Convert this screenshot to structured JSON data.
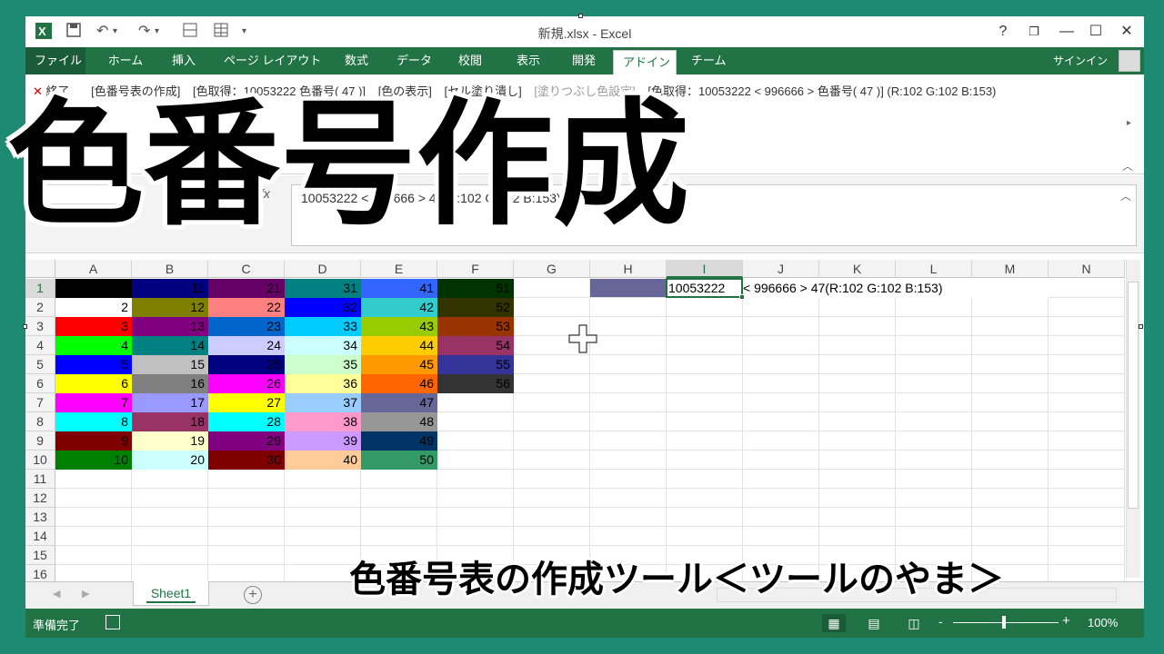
{
  "window": {
    "title": "新規.xlsx - Excel",
    "help_label": "?",
    "restore_label": "❐",
    "minimize_label": "—",
    "maximize_label": "☐",
    "close_label": "✕"
  },
  "quick_access": {
    "excel_icon": "excel-logo-icon",
    "save_icon": "save-icon",
    "undo_icon": "undo-icon",
    "redo_icon": "redo-icon",
    "form_icon": "form-icon",
    "table_icon": "table-icon",
    "customize_icon": "customize-dropdown-icon"
  },
  "ribbon": {
    "tabs": [
      "ファイル",
      "ホーム",
      "挿入",
      "ページ レイアウト",
      "数式",
      "データ",
      "校閲",
      "表示",
      "開発",
      "アドイン",
      "チーム"
    ],
    "active_tab": "アドイン",
    "signin": "サインイン"
  },
  "addin": {
    "close_label": "終了",
    "items": [
      "[色番号表の作成]",
      "[色取得：10053222 色番号( 47 )]",
      "[色の表示]",
      "[セル塗り潰し]",
      "[塗りつぶし色設定]",
      "[色取得：10053222 < 996666 >  色番号( 47 )] (R:102 G:102 B:153)"
    ],
    "disabled_index": 4
  },
  "formula_bar": {
    "fx_label": "fx",
    "formula_text": "10053222 < 996666 > 47(R:102 G:102 B:153)"
  },
  "grid": {
    "columns": [
      "A",
      "B",
      "C",
      "D",
      "E",
      "F",
      "G",
      "H",
      "I",
      "J",
      "K",
      "L",
      "M",
      "N"
    ],
    "selected_column": "I",
    "rows": [
      "1",
      "2",
      "3",
      "4",
      "5",
      "6",
      "7",
      "8",
      "9",
      "10",
      "11",
      "12",
      "13",
      "14",
      "15",
      "16"
    ],
    "selected_row": "1",
    "color_table": [
      [
        {
          "v": "1",
          "bg": "#000000"
        },
        {
          "v": "11",
          "bg": "#000080"
        },
        {
          "v": "21",
          "bg": "#660066"
        },
        {
          "v": "31",
          "bg": "#008080"
        },
        {
          "v": "41",
          "bg": "#3366FF"
        },
        {
          "v": "51",
          "bg": "#003300"
        }
      ],
      [
        {
          "v": "2",
          "bg": "#FFFFFF"
        },
        {
          "v": "12",
          "bg": "#808000"
        },
        {
          "v": "22",
          "bg": "#FF8080"
        },
        {
          "v": "32",
          "bg": "#0000FF"
        },
        {
          "v": "42",
          "bg": "#33CCCC"
        },
        {
          "v": "52",
          "bg": "#333300"
        }
      ],
      [
        {
          "v": "3",
          "bg": "#FF0000"
        },
        {
          "v": "13",
          "bg": "#800080"
        },
        {
          "v": "23",
          "bg": "#0066CC"
        },
        {
          "v": "33",
          "bg": "#00CCFF"
        },
        {
          "v": "43",
          "bg": "#99CC00"
        },
        {
          "v": "53",
          "bg": "#993300"
        }
      ],
      [
        {
          "v": "4",
          "bg": "#00FF00"
        },
        {
          "v": "14",
          "bg": "#008080"
        },
        {
          "v": "24",
          "bg": "#CCCCFF"
        },
        {
          "v": "34",
          "bg": "#CCFFFF"
        },
        {
          "v": "44",
          "bg": "#FFCC00"
        },
        {
          "v": "54",
          "bg": "#993366"
        }
      ],
      [
        {
          "v": "5",
          "bg": "#0000FF"
        },
        {
          "v": "15",
          "bg": "#C0C0C0"
        },
        {
          "v": "25",
          "bg": "#000080"
        },
        {
          "v": "35",
          "bg": "#CCFFCC"
        },
        {
          "v": "45",
          "bg": "#FF9900"
        },
        {
          "v": "55",
          "bg": "#333399"
        }
      ],
      [
        {
          "v": "6",
          "bg": "#FFFF00"
        },
        {
          "v": "16",
          "bg": "#808080"
        },
        {
          "v": "26",
          "bg": "#FF00FF"
        },
        {
          "v": "36",
          "bg": "#FFFF99"
        },
        {
          "v": "46",
          "bg": "#FF6600"
        },
        {
          "v": "56",
          "bg": "#333333"
        }
      ],
      [
        {
          "v": "7",
          "bg": "#FF00FF"
        },
        {
          "v": "17",
          "bg": "#9999FF"
        },
        {
          "v": "27",
          "bg": "#FFFF00"
        },
        {
          "v": "37",
          "bg": "#99CCFF"
        },
        {
          "v": "47",
          "bg": "#666699"
        }
      ],
      [
        {
          "v": "8",
          "bg": "#00FFFF"
        },
        {
          "v": "18",
          "bg": "#993366"
        },
        {
          "v": "28",
          "bg": "#00FFFF"
        },
        {
          "v": "38",
          "bg": "#FF99CC"
        },
        {
          "v": "48",
          "bg": "#969696"
        }
      ],
      [
        {
          "v": "9",
          "bg": "#800000"
        },
        {
          "v": "19",
          "bg": "#FFFFCC"
        },
        {
          "v": "29",
          "bg": "#800080"
        },
        {
          "v": "39",
          "bg": "#CC99FF"
        },
        {
          "v": "49",
          "bg": "#003366"
        }
      ],
      [
        {
          "v": "10",
          "bg": "#008000"
        },
        {
          "v": "20",
          "bg": "#CCFFFF"
        },
        {
          "v": "30",
          "bg": "#800000"
        },
        {
          "v": "40",
          "bg": "#FFCC99"
        },
        {
          "v": "50",
          "bg": "#339966"
        }
      ]
    ],
    "swatch_cell": {
      "col": "H",
      "row": "1",
      "bg": "#666699"
    },
    "active_cell": {
      "col": "I",
      "row": "1",
      "value": "10053222"
    },
    "overflow_text": "< 996666 > 47(R:102 G:102 B:153)"
  },
  "sheets": {
    "tabs": [
      "Sheet1"
    ],
    "add_label": "+"
  },
  "status": {
    "ready": "準備完了",
    "zoom": "100%",
    "zoom_minus": "-",
    "zoom_plus": "+"
  },
  "overlay": {
    "title": "色番号作成",
    "subtitle": "色番号表の作成ツール＜ツールのやま＞"
  }
}
